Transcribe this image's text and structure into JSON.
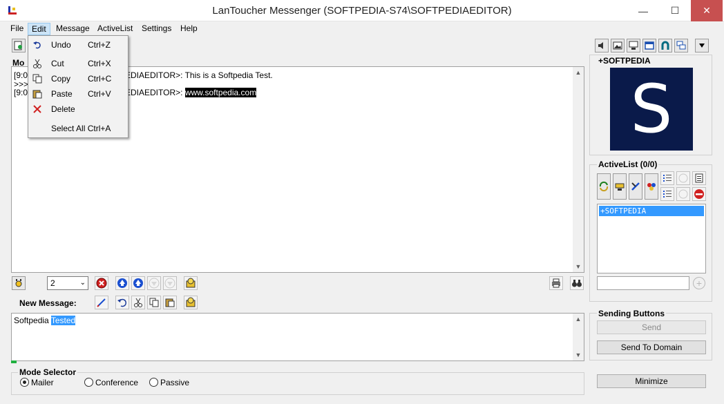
{
  "window": {
    "title": "LanToucher Messenger (SOFTPEDIA-S74\\SOFTPEDIAEDITOR)",
    "minimize": "—",
    "maximize": "☐",
    "close": "✕"
  },
  "menu": {
    "items": [
      "File",
      "Edit",
      "Message",
      "ActiveList",
      "Settings",
      "Help"
    ],
    "active": "Edit"
  },
  "edit_menu": {
    "undo": {
      "label": "Undo",
      "shortcut": "Ctrl+Z"
    },
    "cut": {
      "label": "Cut",
      "shortcut": "Ctrl+X"
    },
    "copy": {
      "label": "Copy",
      "shortcut": "Ctrl+C"
    },
    "paste": {
      "label": "Paste",
      "shortcut": "Ctrl+V"
    },
    "delete": {
      "label": "Delete"
    },
    "select_all": {
      "label": "Select All Ctrl+A"
    }
  },
  "messages": {
    "header_label": "Mo",
    "lines": [
      {
        "prefix": "[9:0",
        "text": "PEDIAEDITOR>: This is a Softpedia Test."
      },
      {
        "prefix": ">>>",
        "text": ""
      },
      {
        "prefix": "[9:0",
        "text": "PEDIAEDITOR>: ",
        "highlight": "www.softpedia.com"
      }
    ]
  },
  "history_toolbar": {
    "count_value": "2"
  },
  "new_message": {
    "label": "New Message:",
    "text_plain": "Softpedia ",
    "text_selected": "Tested"
  },
  "mode_selector": {
    "title": "Mode Selector",
    "options": [
      "Mailer",
      "Conference",
      "Passive"
    ],
    "selected": "Mailer"
  },
  "contact": {
    "name": "+SOFTPEDIA",
    "avatar_letter": "S",
    "avatar_bg": "#0a1a4a"
  },
  "active_list": {
    "title": "ActiveList (0/0)",
    "items": [
      "+SOFTPEDIA"
    ],
    "search_value": ""
  },
  "sending_buttons": {
    "title": "Sending Buttons",
    "send": "Send",
    "send_to_domain": "Send To Domain"
  },
  "minimize_button": "Minimize",
  "colors": {
    "selection": "#3399ff",
    "list_selection": "#3399ff",
    "close_red": "#c75050"
  }
}
